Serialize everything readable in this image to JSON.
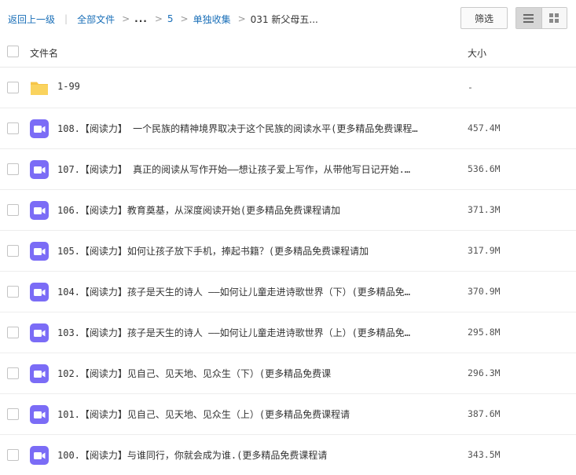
{
  "breadcrumb": {
    "back": "返回上一级",
    "all_files": "全部文件",
    "ellipsis": "...",
    "level_5": "5",
    "level_solo": "单独收集",
    "current": "031 新父母五..."
  },
  "toolbar": {
    "filter_label": "筛选",
    "list_view_icon": "list-icon",
    "grid_view_icon": "grid-icon"
  },
  "columns": {
    "name": "文件名",
    "size": "大小"
  },
  "colors": {
    "link": "#1a6fb8",
    "folder": "#f6c548",
    "video_icon": "#7b6cf6"
  },
  "files": [
    {
      "name": "1-99",
      "size": "-",
      "type": "folder"
    },
    {
      "name": "108.【阅读力】 一个民族的精神境界取决于这个民族的阅读水平(更多精品免费课程…",
      "size": "457.4M",
      "type": "video"
    },
    {
      "name": "107.【阅读力】 真正的阅读从写作开始——想让孩子爱上写作，从带他写日记开始.…",
      "size": "536.6M",
      "type": "video"
    },
    {
      "name": "106.【阅读力】教育奠基，从深度阅读开始(更多精品免费课程请加",
      "size": "371.3M",
      "type": "video"
    },
    {
      "name": "105.【阅读力】如何让孩子放下手机，捧起书籍？(更多精品免费课程请加",
      "size": "317.9M",
      "type": "video"
    },
    {
      "name": "104.【阅读力】孩子是天生的诗人 ——如何让儿童走进诗歌世界（下）(更多精品免…",
      "size": "370.9M",
      "type": "video"
    },
    {
      "name": "103.【阅读力】孩子是天生的诗人 ——如何让儿童走进诗歌世界（上）(更多精品免…",
      "size": "295.8M",
      "type": "video"
    },
    {
      "name": "102.【阅读力】见自己、见天地、见众生（下）(更多精品免费课",
      "size": "296.3M",
      "type": "video"
    },
    {
      "name": "101.【阅读力】见自己、见天地、见众生（上）(更多精品免费课程请",
      "size": "387.6M",
      "type": "video"
    },
    {
      "name": "100.【阅读力】与谁同行，你就会成为谁.(更多精品免费课程请",
      "size": "343.5M",
      "type": "video"
    }
  ]
}
